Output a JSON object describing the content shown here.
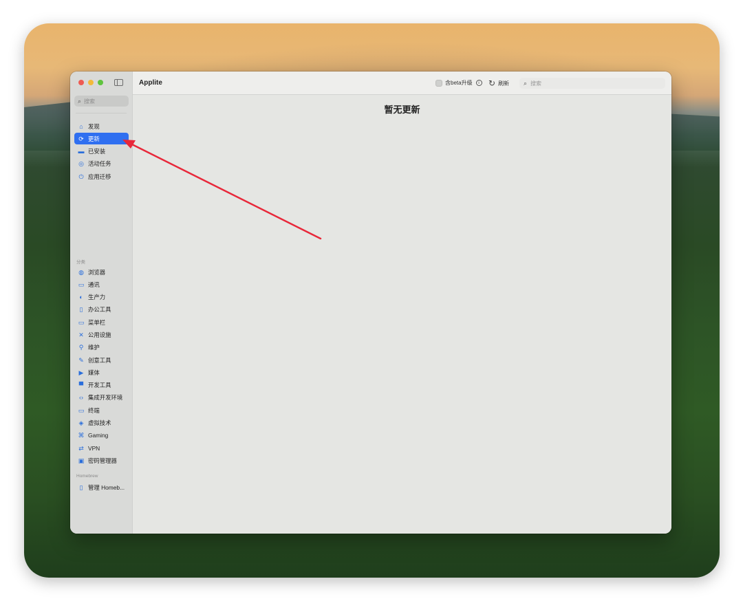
{
  "app": {
    "title": "Applite"
  },
  "sidebar": {
    "search_placeholder": "搜索",
    "primary": [
      {
        "label": "发现",
        "icon": "home-icon",
        "active": false
      },
      {
        "label": "更新",
        "icon": "update-icon",
        "active": true
      },
      {
        "label": "已安装",
        "icon": "drive-icon",
        "active": false
      },
      {
        "label": "活动任务",
        "icon": "activity-icon",
        "active": false
      },
      {
        "label": "应用迁移",
        "icon": "migrate-icon",
        "active": false
      }
    ],
    "category_label": "分类",
    "categories": [
      {
        "label": "浏览器",
        "icon": "globe-icon"
      },
      {
        "label": "通讯",
        "icon": "chat-icon"
      },
      {
        "label": "生产力",
        "icon": "productivity-icon"
      },
      {
        "label": "办公工具",
        "icon": "document-icon"
      },
      {
        "label": "菜单栏",
        "icon": "menubar-icon"
      },
      {
        "label": "公用设施",
        "icon": "tools-icon"
      },
      {
        "label": "维护",
        "icon": "wrench-icon"
      },
      {
        "label": "创意工具",
        "icon": "pencil-icon"
      },
      {
        "label": "媒体",
        "icon": "play-icon"
      },
      {
        "label": "开发工具",
        "icon": "monitor-icon"
      },
      {
        "label": "集成开发环境",
        "icon": "code-icon"
      },
      {
        "label": "终端",
        "icon": "terminal-icon"
      },
      {
        "label": "虚拟技术",
        "icon": "cube-icon"
      },
      {
        "label": "Gaming",
        "icon": "gamepad-icon"
      },
      {
        "label": "VPN",
        "icon": "vpn-icon"
      },
      {
        "label": "密码管理器",
        "icon": "key-icon"
      }
    ],
    "homebrew_label": "Homebrew",
    "homebrew": [
      {
        "label": "管理 Homeb...",
        "icon": "homebrew-icon"
      }
    ]
  },
  "toolbar": {
    "beta_label": "含beta升级",
    "refresh_label": "刷新",
    "search_placeholder": "搜索"
  },
  "main": {
    "empty_message": "暂无更新"
  },
  "colors": {
    "accent": "#2f6ff0",
    "annotation_arrow": "#e8283a"
  }
}
